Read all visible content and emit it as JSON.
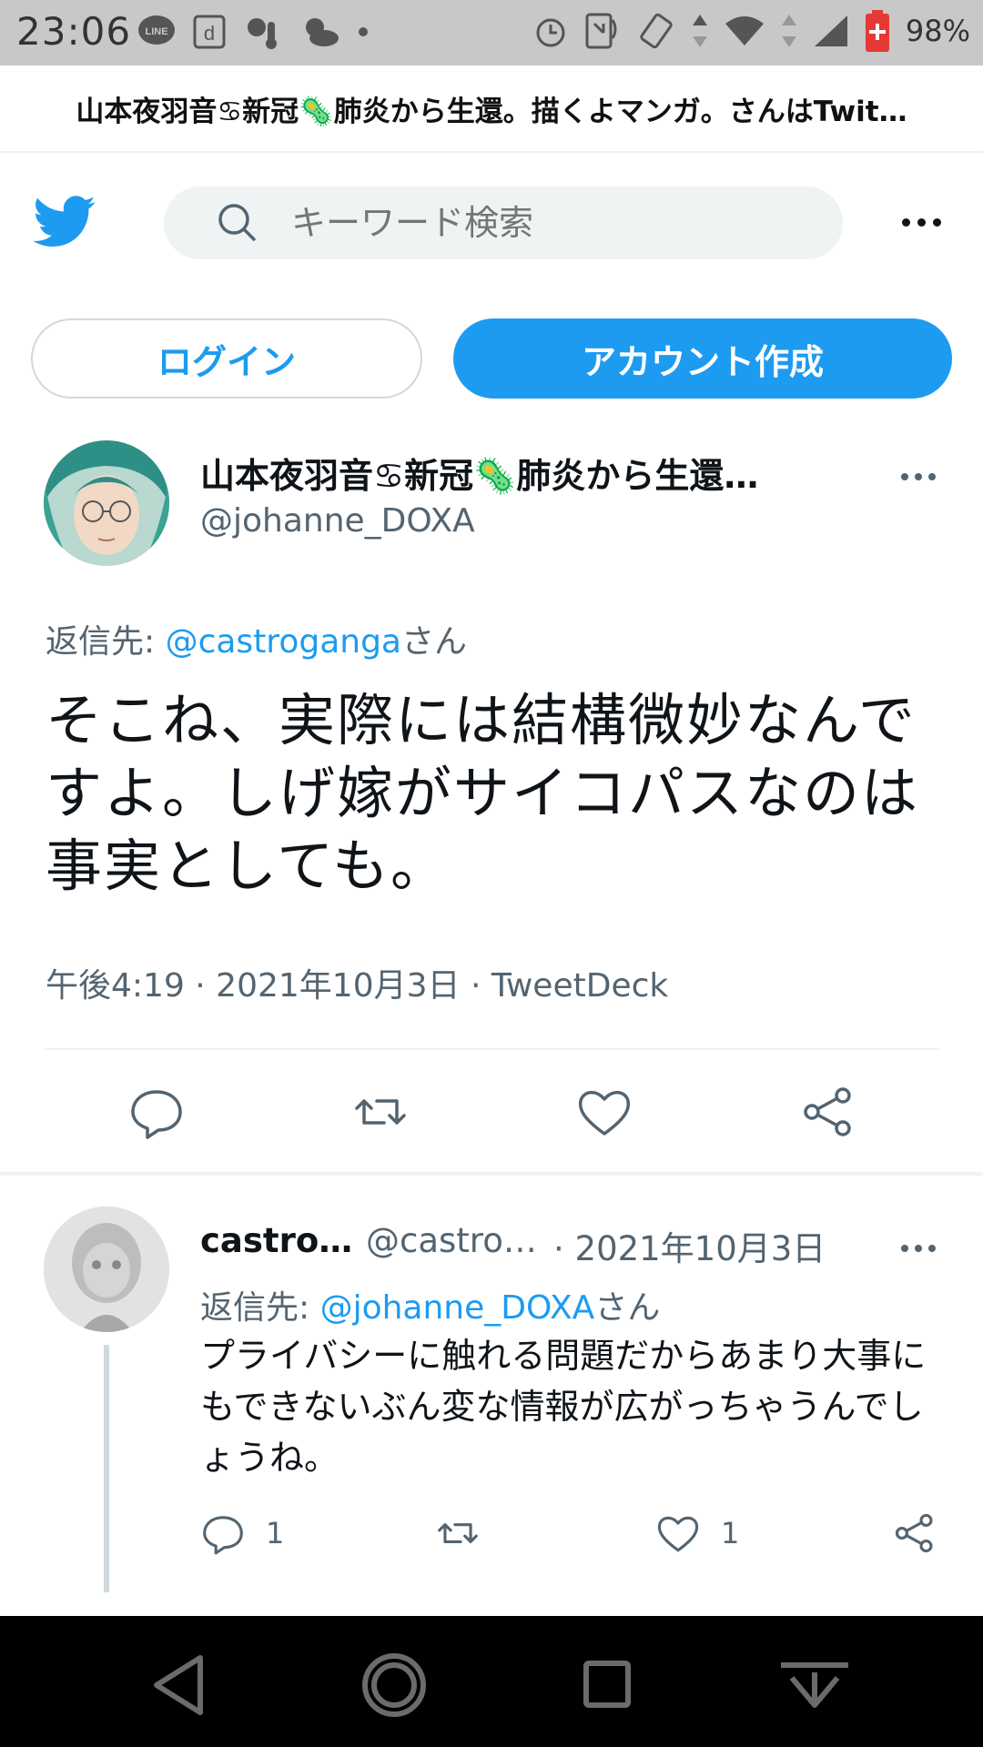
{
  "status_bar": {
    "time": "23:06",
    "battery_percent": "98%",
    "notification_icons": [
      "line-icon",
      "d-icon",
      "weather-icon",
      "weather-icon",
      "dot-icon"
    ],
    "system_icons": [
      "alarm-icon",
      "nfc-icon",
      "rotate-icon",
      "data-arrows-icon",
      "wifi-icon",
      "signal-icon",
      "battery-icon"
    ]
  },
  "page_title": "山本夜羽音♋新冠🦠肺炎から生還。描くよマンガ。さんはTwit…",
  "header": {
    "search_placeholder": "キーワード検索"
  },
  "auth": {
    "login_label": "ログイン",
    "signup_label": "アカウント作成"
  },
  "tweet": {
    "author_name": "山本夜羽音♋新冠🦠肺炎から生還…",
    "author_handle": "@johanne_DOXA",
    "reply_prefix": "返信先: ",
    "reply_mention": "@castroganga",
    "reply_suffix": "さん",
    "text": "そこね、実際には結構微妙なんですよ。しげ嫁がサイコパスなのは事実としても。",
    "meta": "午後4:19 · 2021年10月3日 · TweetDeck"
  },
  "reply": {
    "author_name": "castro…",
    "author_handle": "@castro…",
    "date": "· 2021年10月3日",
    "reply_prefix": "返信先: ",
    "reply_mention": "@johanne_DOXA",
    "reply_suffix": "さん",
    "text": "プライバシーに触れる問題だからあまり大事にもできないぶん変な情報が広がっちゃうんでしょうね。",
    "reply_count": "1",
    "like_count": "1"
  },
  "colors": {
    "accent": "#1d9bf0",
    "secondary_text": "#536471",
    "status_bar": "#c8c8c8",
    "nav_bar": "#000000"
  }
}
